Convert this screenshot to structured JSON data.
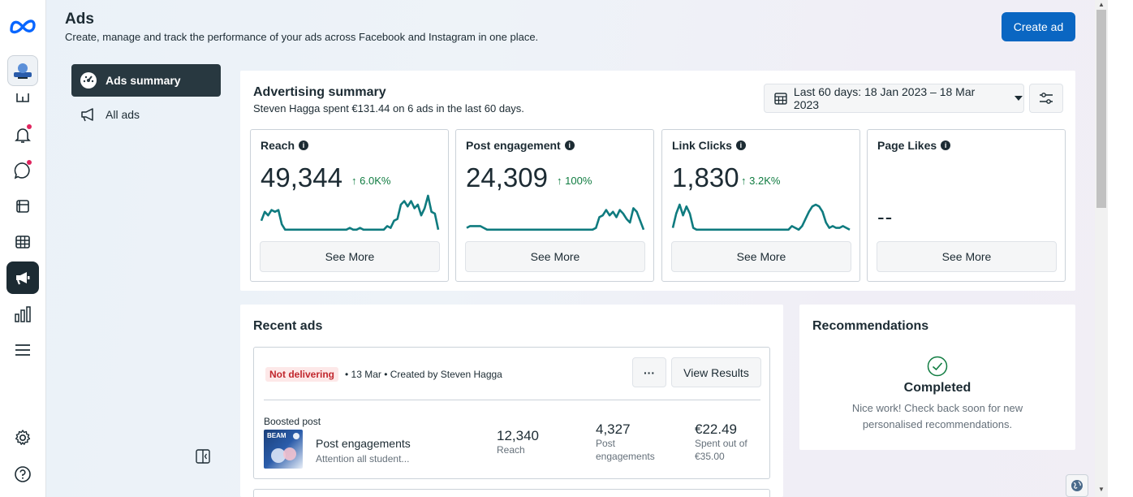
{
  "header": {
    "title": "Ads",
    "subtitle": "Create, manage and track the performance of your ads across Facebook and Instagram in one place.",
    "create_button": "Create ad"
  },
  "nav": {
    "items": [
      {
        "label": "Ads summary",
        "icon": "dashboard-icon",
        "active": true
      },
      {
        "label": "All ads",
        "icon": "megaphone-icon",
        "active": false
      }
    ]
  },
  "rail": {
    "icons": [
      "meta-logo",
      "page-avatar",
      "home-icon",
      "notifications-icon",
      "messages-icon",
      "content-icon",
      "planner-icon",
      "ads-icon",
      "insights-icon",
      "menu-icon",
      "settings-icon",
      "help-icon"
    ]
  },
  "summary": {
    "title": "Advertising summary",
    "subtitle": "Steven Hagga spent €131.44 on 6 ads in the last 60 days.",
    "date_range": "Last 60 days: 18 Jan 2023 – 18 Mar 2023",
    "metrics": [
      {
        "title": "Reach",
        "value": "49,344",
        "change": "6.0K%",
        "see_more": "See More",
        "trend": [
          0.3,
          0.55,
          0.45,
          0.6,
          0.55,
          0.6,
          0.2,
          0.05,
          0.05,
          0.05,
          0.05,
          0.05,
          0.05,
          0.05,
          0.05,
          0.05,
          0.05,
          0.05,
          0.05,
          0.05,
          0.05,
          0.05,
          0.05,
          0.05,
          0.05,
          0.05,
          0.1,
          0.05,
          0.05,
          0.1,
          0.05,
          0.05,
          0.05,
          0.05,
          0.05,
          0.05,
          0.05,
          0.15,
          0.1,
          0.3,
          0.35,
          0.75,
          0.85,
          0.7,
          0.85,
          0.65,
          0.75,
          0.45,
          0.65,
          1.0,
          0.55,
          0.5,
          0.05
        ]
      },
      {
        "title": "Post engagement",
        "value": "24,309",
        "change": "100%",
        "see_more": "See More",
        "trend": [
          0.1,
          0.15,
          0.15,
          0.15,
          0.15,
          0.1,
          0.05,
          0.05,
          0.05,
          0.05,
          0.05,
          0.05,
          0.05,
          0.05,
          0.05,
          0.05,
          0.05,
          0.05,
          0.05,
          0.05,
          0.05,
          0.05,
          0.05,
          0.05,
          0.05,
          0.05,
          0.05,
          0.05,
          0.05,
          0.05,
          0.05,
          0.05,
          0.05,
          0.05,
          0.05,
          0.05,
          0.05,
          0.05,
          0.1,
          0.4,
          0.45,
          0.6,
          0.45,
          0.55,
          0.4,
          0.6,
          0.5,
          0.35,
          0.25,
          0.65,
          0.55,
          0.3,
          0.05
        ]
      },
      {
        "title": "Link Clicks",
        "value": "1,830",
        "change": "3.2K%",
        "see_more": "See More",
        "trend": [
          0.1,
          0.5,
          0.75,
          0.45,
          0.7,
          0.5,
          0.1,
          0.05,
          0.05,
          0.05,
          0.05,
          0.05,
          0.05,
          0.05,
          0.05,
          0.05,
          0.05,
          0.05,
          0.05,
          0.05,
          0.05,
          0.05,
          0.05,
          0.05,
          0.05,
          0.05,
          0.05,
          0.05,
          0.05,
          0.05,
          0.05,
          0.05,
          0.05,
          0.05,
          0.05,
          0.15,
          0.1,
          0.05,
          0.15,
          0.35,
          0.55,
          0.7,
          0.75,
          0.7,
          0.55,
          0.25,
          0.1,
          0.15,
          0.1,
          0.1,
          0.15,
          0.1,
          0.05
        ]
      },
      {
        "title": "Page Likes",
        "value": "--",
        "change": "",
        "see_more": "See More",
        "trend": []
      }
    ]
  },
  "recent_ads": {
    "title": "Recent ads",
    "ad": {
      "status": "Not delivering",
      "meta": "• 13 Mar • Created by Steven Hagga",
      "more_label": "···",
      "view_results": "View Results",
      "type": "Boosted post",
      "name": "Post engagements",
      "description": "Attention all student...",
      "thumb_text": "BEAM",
      "stats": [
        {
          "value": "12,340",
          "label": "Reach"
        },
        {
          "value": "4,327",
          "label": "Post engagements"
        },
        {
          "value": "€22.49",
          "label": "Spent out of €35.00"
        }
      ]
    }
  },
  "recommendations": {
    "title": "Recommendations",
    "status": "Completed",
    "message": "Nice work! Check back soon for new personalised recommendations."
  },
  "colors": {
    "accent": "#0a66c2",
    "chart_line": "#0f7b7f",
    "positive": "#107c41",
    "nav_active": "#283840",
    "badge_bg": "#fde8e8",
    "badge_text": "#c1272d"
  }
}
